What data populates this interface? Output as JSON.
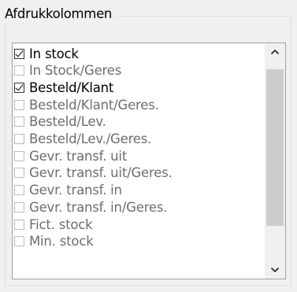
{
  "group": {
    "title": "Afdrukkolommen"
  },
  "list": {
    "items": [
      {
        "label": "In stock",
        "checked": true,
        "enabled": true
      },
      {
        "label": "In Stock/Geres",
        "checked": false,
        "enabled": false
      },
      {
        "label": "Besteld/Klant",
        "checked": true,
        "enabled": true
      },
      {
        "label": "Besteld/Klant/Geres.",
        "checked": false,
        "enabled": false
      },
      {
        "label": "Besteld/Lev.",
        "checked": false,
        "enabled": false
      },
      {
        "label": "Besteld/Lev./Geres.",
        "checked": false,
        "enabled": false
      },
      {
        "label": "Gevr. transf. uit",
        "checked": false,
        "enabled": false
      },
      {
        "label": "Gevr. transf. uit/Geres.",
        "checked": false,
        "enabled": false
      },
      {
        "label": "Gevr. transf. in",
        "checked": false,
        "enabled": false
      },
      {
        "label": "Gevr. transf. in/Geres.",
        "checked": false,
        "enabled": false
      },
      {
        "label": "Fict. stock",
        "checked": false,
        "enabled": false
      },
      {
        "label": "Min. stock",
        "checked": false,
        "enabled": false
      }
    ]
  },
  "scrollbar": {
    "up_icon": "chevron-up-icon",
    "down_icon": "chevron-down-icon"
  }
}
